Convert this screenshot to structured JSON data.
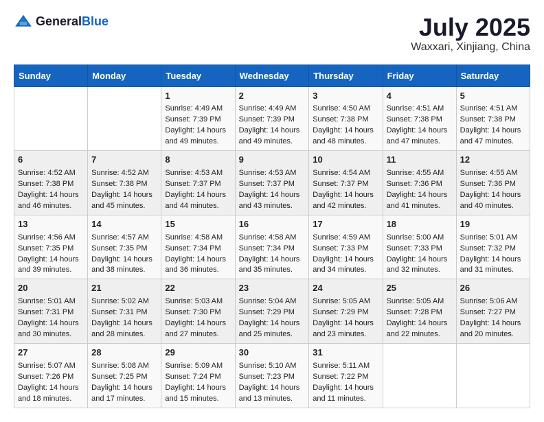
{
  "header": {
    "logo_general": "General",
    "logo_blue": "Blue",
    "month": "July 2025",
    "location": "Waxxari, Xinjiang, China"
  },
  "weekdays": [
    "Sunday",
    "Monday",
    "Tuesday",
    "Wednesday",
    "Thursday",
    "Friday",
    "Saturday"
  ],
  "weeks": [
    [
      {
        "day": "",
        "info": ""
      },
      {
        "day": "",
        "info": ""
      },
      {
        "day": "1",
        "info": "Sunrise: 4:49 AM\nSunset: 7:39 PM\nDaylight: 14 hours and 49 minutes."
      },
      {
        "day": "2",
        "info": "Sunrise: 4:49 AM\nSunset: 7:39 PM\nDaylight: 14 hours and 49 minutes."
      },
      {
        "day": "3",
        "info": "Sunrise: 4:50 AM\nSunset: 7:38 PM\nDaylight: 14 hours and 48 minutes."
      },
      {
        "day": "4",
        "info": "Sunrise: 4:51 AM\nSunset: 7:38 PM\nDaylight: 14 hours and 47 minutes."
      },
      {
        "day": "5",
        "info": "Sunrise: 4:51 AM\nSunset: 7:38 PM\nDaylight: 14 hours and 47 minutes."
      }
    ],
    [
      {
        "day": "6",
        "info": "Sunrise: 4:52 AM\nSunset: 7:38 PM\nDaylight: 14 hours and 46 minutes."
      },
      {
        "day": "7",
        "info": "Sunrise: 4:52 AM\nSunset: 7:38 PM\nDaylight: 14 hours and 45 minutes."
      },
      {
        "day": "8",
        "info": "Sunrise: 4:53 AM\nSunset: 7:37 PM\nDaylight: 14 hours and 44 minutes."
      },
      {
        "day": "9",
        "info": "Sunrise: 4:53 AM\nSunset: 7:37 PM\nDaylight: 14 hours and 43 minutes."
      },
      {
        "day": "10",
        "info": "Sunrise: 4:54 AM\nSunset: 7:37 PM\nDaylight: 14 hours and 42 minutes."
      },
      {
        "day": "11",
        "info": "Sunrise: 4:55 AM\nSunset: 7:36 PM\nDaylight: 14 hours and 41 minutes."
      },
      {
        "day": "12",
        "info": "Sunrise: 4:55 AM\nSunset: 7:36 PM\nDaylight: 14 hours and 40 minutes."
      }
    ],
    [
      {
        "day": "13",
        "info": "Sunrise: 4:56 AM\nSunset: 7:35 PM\nDaylight: 14 hours and 39 minutes."
      },
      {
        "day": "14",
        "info": "Sunrise: 4:57 AM\nSunset: 7:35 PM\nDaylight: 14 hours and 38 minutes."
      },
      {
        "day": "15",
        "info": "Sunrise: 4:58 AM\nSunset: 7:34 PM\nDaylight: 14 hours and 36 minutes."
      },
      {
        "day": "16",
        "info": "Sunrise: 4:58 AM\nSunset: 7:34 PM\nDaylight: 14 hours and 35 minutes."
      },
      {
        "day": "17",
        "info": "Sunrise: 4:59 AM\nSunset: 7:33 PM\nDaylight: 14 hours and 34 minutes."
      },
      {
        "day": "18",
        "info": "Sunrise: 5:00 AM\nSunset: 7:33 PM\nDaylight: 14 hours and 32 minutes."
      },
      {
        "day": "19",
        "info": "Sunrise: 5:01 AM\nSunset: 7:32 PM\nDaylight: 14 hours and 31 minutes."
      }
    ],
    [
      {
        "day": "20",
        "info": "Sunrise: 5:01 AM\nSunset: 7:31 PM\nDaylight: 14 hours and 30 minutes."
      },
      {
        "day": "21",
        "info": "Sunrise: 5:02 AM\nSunset: 7:31 PM\nDaylight: 14 hours and 28 minutes."
      },
      {
        "day": "22",
        "info": "Sunrise: 5:03 AM\nSunset: 7:30 PM\nDaylight: 14 hours and 27 minutes."
      },
      {
        "day": "23",
        "info": "Sunrise: 5:04 AM\nSunset: 7:29 PM\nDaylight: 14 hours and 25 minutes."
      },
      {
        "day": "24",
        "info": "Sunrise: 5:05 AM\nSunset: 7:29 PM\nDaylight: 14 hours and 23 minutes."
      },
      {
        "day": "25",
        "info": "Sunrise: 5:05 AM\nSunset: 7:28 PM\nDaylight: 14 hours and 22 minutes."
      },
      {
        "day": "26",
        "info": "Sunrise: 5:06 AM\nSunset: 7:27 PM\nDaylight: 14 hours and 20 minutes."
      }
    ],
    [
      {
        "day": "27",
        "info": "Sunrise: 5:07 AM\nSunset: 7:26 PM\nDaylight: 14 hours and 18 minutes."
      },
      {
        "day": "28",
        "info": "Sunrise: 5:08 AM\nSunset: 7:25 PM\nDaylight: 14 hours and 17 minutes."
      },
      {
        "day": "29",
        "info": "Sunrise: 5:09 AM\nSunset: 7:24 PM\nDaylight: 14 hours and 15 minutes."
      },
      {
        "day": "30",
        "info": "Sunrise: 5:10 AM\nSunset: 7:23 PM\nDaylight: 14 hours and 13 minutes."
      },
      {
        "day": "31",
        "info": "Sunrise: 5:11 AM\nSunset: 7:22 PM\nDaylight: 14 hours and 11 minutes."
      },
      {
        "day": "",
        "info": ""
      },
      {
        "day": "",
        "info": ""
      }
    ]
  ]
}
